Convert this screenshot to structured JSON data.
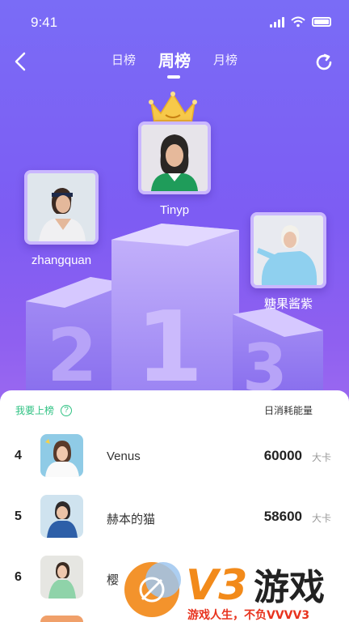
{
  "status": {
    "time": "9:41"
  },
  "header": {
    "tabs": [
      {
        "label": "日榜"
      },
      {
        "label": "周榜"
      },
      {
        "label": "月榜"
      }
    ]
  },
  "podium": {
    "first": {
      "name": "Tinyp"
    },
    "second": {
      "name": "zhangquan"
    },
    "third": {
      "name": "糖果酱紫"
    }
  },
  "list": {
    "join_label": "我要上榜",
    "column_header": "日消耗能量",
    "rows": [
      {
        "rank": "4",
        "name": "Venus",
        "score": "60000",
        "unit": "大卡"
      },
      {
        "rank": "5",
        "name": "赫本的猫",
        "score": "58600",
        "unit": "大卡"
      },
      {
        "rank": "6",
        "name": "樱",
        "score": "",
        "unit": ""
      }
    ]
  },
  "watermark": {
    "brand": "V3游戏",
    "slogan": "游戏人生，不负VVVV3"
  },
  "colors": {
    "accent_green": "#2fc283",
    "bg_top": "#7a6cf6",
    "bg_bottom": "#a06df0",
    "crown": "#f7c94a",
    "watermark_orange": "#f28a1a"
  }
}
